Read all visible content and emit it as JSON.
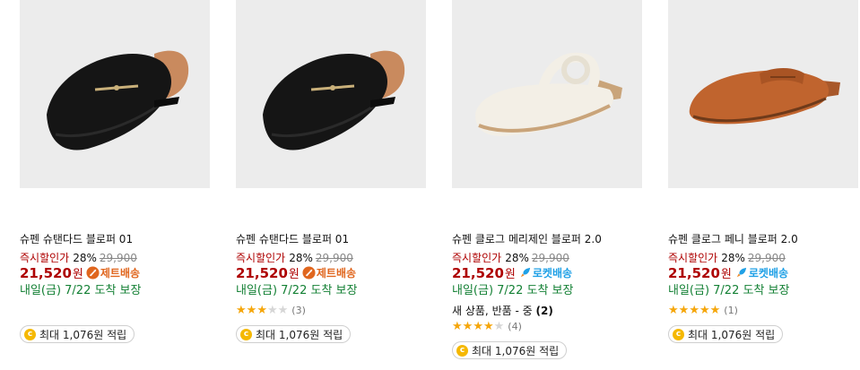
{
  "products": [
    {
      "name": "슈펜 슈탠다드 블로퍼 01",
      "discount_label": "즉시할인가",
      "discount_pct": "28%",
      "original_price": "29,900",
      "price": "21,520",
      "currency": "원",
      "delivery_badge": "제트배송",
      "delivery_icon": "jet-icon",
      "arrival": "내일(금) 7/22 도착 보장",
      "reward": "최대 1,076원 적립",
      "image_icon": "black-mule-loafer"
    },
    {
      "name": "슈펜 슈탠다드 블로퍼 01",
      "discount_label": "즉시할인가",
      "discount_pct": "28%",
      "original_price": "29,900",
      "price": "21,520",
      "currency": "원",
      "delivery_badge": "제트배송",
      "delivery_icon": "jet-icon",
      "arrival": "내일(금) 7/22 도착 보장",
      "rating": 3,
      "rating_count": "(3)",
      "reward": "최대 1,076원 적립",
      "image_icon": "black-mule-loafer"
    },
    {
      "name": "슈펜 클로그 메리제인 블로퍼 2.0",
      "discount_label": "즉시할인가",
      "discount_pct": "28%",
      "original_price": "29,900",
      "price": "21,520",
      "currency": "원",
      "delivery_badge": "로켓배송",
      "delivery_icon": "rocket-icon",
      "arrival": "내일(금) 7/22 도착 보장",
      "extra_text": "새 상품, 반품 - 중",
      "extra_count": "(2)",
      "rating": 4,
      "rating_count": "(4)",
      "reward": "최대 1,076원 적립",
      "image_icon": "white-maryjane-mule"
    },
    {
      "name": "슈펜 클로그 페니 블로퍼 2.0",
      "discount_label": "즉시할인가",
      "discount_pct": "28%",
      "original_price": "29,900",
      "price": "21,520",
      "currency": "원",
      "delivery_badge": "로켓배송",
      "delivery_icon": "rocket-icon",
      "arrival": "내일(금) 7/22 도착 보장",
      "rating": 5,
      "rating_count": "(1)",
      "reward": "최대 1,076원 적립",
      "image_icon": "brown-penny-mule"
    }
  ],
  "colors": {
    "price_red": "#ae0000",
    "arrival_green": "#138034",
    "jet_orange": "#e0661e",
    "rocket_blue": "#1fa0e6",
    "star_gold": "#f5a60a",
    "coin_gold": "#f5b800"
  }
}
